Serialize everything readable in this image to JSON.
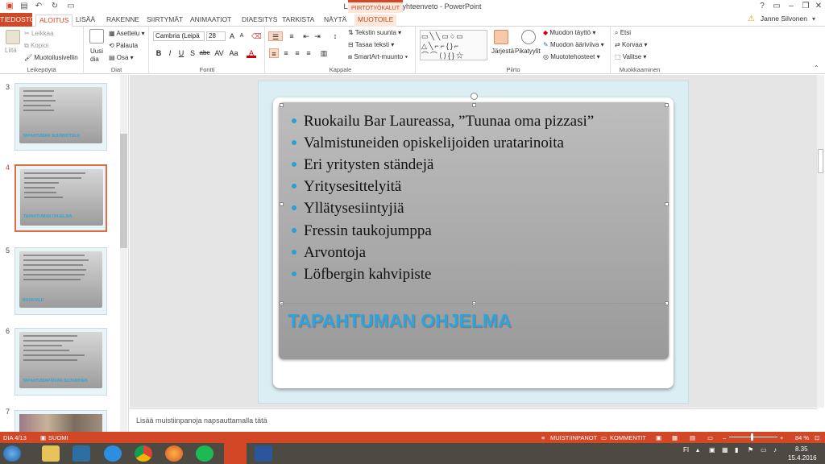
{
  "titlebar": {
    "title": "LAUREAFLASH-_yhteenveto - PowerPoint",
    "context_group": "PIIRTOTYÖKALUT",
    "help": "?",
    "minimize": "–",
    "restore": "❐",
    "close": "✕"
  },
  "tabs": [
    "TIEDOSTO",
    "ALOITUS",
    "LISÄÄ",
    "RAKENNE",
    "SIIRTYMÄT",
    "ANIMAATIOT",
    "DIAESITYS",
    "TARKISTA",
    "NÄYTÄ",
    "MUOTOILE"
  ],
  "user": "Janne Silvonen",
  "ribbon": {
    "clipboard": {
      "paste": "Liitä",
      "cut": "Leikkaa",
      "copy": "Kopioi",
      "format_painter": "Muotoilusivellin",
      "label": "Leikepöytä"
    },
    "slides": {
      "new_slide": "Uusi",
      "new_slide2": "dia",
      "layout": "Asettelu",
      "reset": "Palauta",
      "section": "Osa",
      "label": "Diat"
    },
    "font": {
      "name": "Cambria (Leipä",
      "size": "28",
      "bold": "B",
      "italic": "I",
      "underline": "U",
      "shadow": "S",
      "strike": "abc",
      "label": "Fontti"
    },
    "paragraph": {
      "text_direction": "Tekstin suunta",
      "align_text": "Tasaa teksti",
      "smartart": "SmartArt-muunto",
      "label": "Kappale"
    },
    "drawing": {
      "arrange": "Järjestä",
      "quick_styles": "Pikatyylit",
      "fill": "Muodon täyttö",
      "outline": "Muodon ääriviiva",
      "effects": "Muototehosteet",
      "label": "Piirto"
    },
    "editing": {
      "find": "Etsi",
      "replace": "Korvaa",
      "select": "Valitse",
      "label": "Muokkaaminen"
    }
  },
  "thumbnails": [
    {
      "num": "3",
      "title": "TAPAHTUMAN SUUNNITTELU"
    },
    {
      "num": "4",
      "title": "TAPAHTUMAN OHJELMA"
    },
    {
      "num": "5",
      "title": "RUOKAILU"
    },
    {
      "num": "6",
      "title": "TAPAHTUMAPÄIVÄN SUJUMINEN"
    },
    {
      "num": "7",
      "title": ""
    }
  ],
  "slide": {
    "bullets": [
      "Ruokailu Bar Laureassa, ”Tuunaa oma pizzasi”",
      "Valmistuneiden opiskelijoiden uratarinoita",
      "Eri yritysten ständejä",
      "Yritysesittelyitä",
      "Yllätysesiintyjiä",
      "Fressin taukojumppa",
      "Arvontoja",
      "Löfbergin kahvipiste"
    ],
    "title": "TAPAHTUMAN OHJELMA"
  },
  "notes_placeholder": "Lisää muistiinpanoja napsauttamalla tätä",
  "status": {
    "slide": "DIA 4/13",
    "language": "SUOMI",
    "notes": "MUISTIINPANOT",
    "comments": "KOMMENTIT",
    "zoom": "84 %"
  },
  "taskbar": {
    "lang": "FI",
    "time": "8.35",
    "date": "15.4.2016"
  },
  "colors": {
    "accent": "#d24726",
    "title_blue": "#2fa3dc",
    "bullet": "#2a9fd6"
  }
}
